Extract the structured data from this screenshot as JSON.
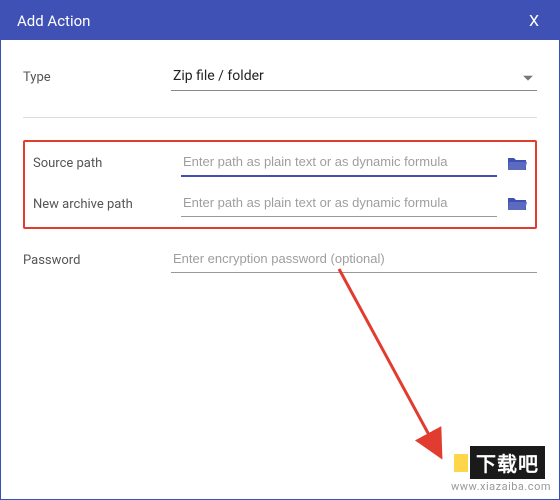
{
  "dialog": {
    "title": "Add Action",
    "close_label": "X"
  },
  "form": {
    "type_label": "Type",
    "type_value": "Zip file / folder",
    "source_label": "Source path",
    "source_value": "",
    "source_placeholder": "Enter path as plain text or as dynamic formula",
    "archive_label": "New archive path",
    "archive_value": "",
    "archive_placeholder": "Enter path as plain text or as dynamic formula",
    "password_label": "Password",
    "password_value": "",
    "password_placeholder": "Enter encryption password (optional)"
  },
  "watermark": "www.xiazaiba.com",
  "logo_text": "下载吧"
}
